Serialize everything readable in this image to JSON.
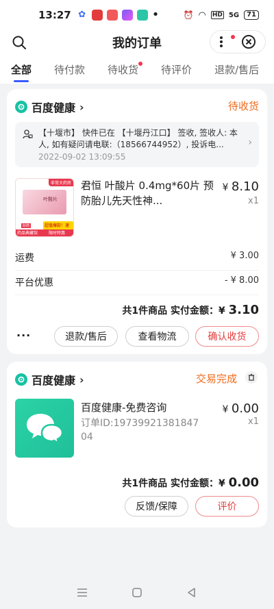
{
  "statusbar": {
    "time": "13:27",
    "battery": "71",
    "hd": "HD",
    "signal": "5G"
  },
  "header": {
    "title": "我的订单"
  },
  "tabs": [
    {
      "label": "全部",
      "active": true
    },
    {
      "label": "待付款"
    },
    {
      "label": "待收货",
      "dot": true
    },
    {
      "label": "待评价"
    },
    {
      "label": "退款/售后"
    }
  ],
  "order1": {
    "shop": "百度健康",
    "status": "待收货",
    "logistics_text": "【十堰市】 快件已在 【十堰丹江口】 签收, 签收人: 本人, 如有疑问请电联:（18566744952）, 投诉电...",
    "logistics_date": "2022-09-02 13:09:55",
    "product_name": "君恒 叶酸片 0.4mg*60片 预防胎儿先天性神...",
    "price_symbol": "¥",
    "price": "8.10",
    "qty": "x1",
    "img_badge_top": "非常大药房",
    "img_label": "叶酸片",
    "img_tag1": "超值爆款！速发",
    "img_tag2": "限时特惠",
    "img_tag3": "好药",
    "img_tag4": "药品典藏馆",
    "shipping_label": "运费",
    "shipping_value": "¥ 3.00",
    "discount_label": "平台优惠",
    "discount_value": "- ¥ 8.00",
    "total_prefix": "共1件商品  实付金额：",
    "total_symbol": "¥ ",
    "total_amount": "3.10",
    "more": "···",
    "btn_refund": "退款/售后",
    "btn_track": "查看物流",
    "btn_confirm": "确认收货"
  },
  "order2": {
    "shop": "百度健康",
    "status": "交易完成",
    "product_name": "百度健康-免费咨询",
    "order_id": "订单ID:1973992138184704",
    "price_symbol": "¥",
    "price": "0.00",
    "qty": "x1",
    "total_prefix": "共1件商品  实付金额：",
    "total_symbol": "¥ ",
    "total_amount": "0.00",
    "btn_feedback": "反馈/保障",
    "btn_review": "评价"
  },
  "colors": {
    "accent": "#3a5bff",
    "orange": "#f06a1b",
    "red": "#e23c3c",
    "teal": "#17c2a4"
  }
}
